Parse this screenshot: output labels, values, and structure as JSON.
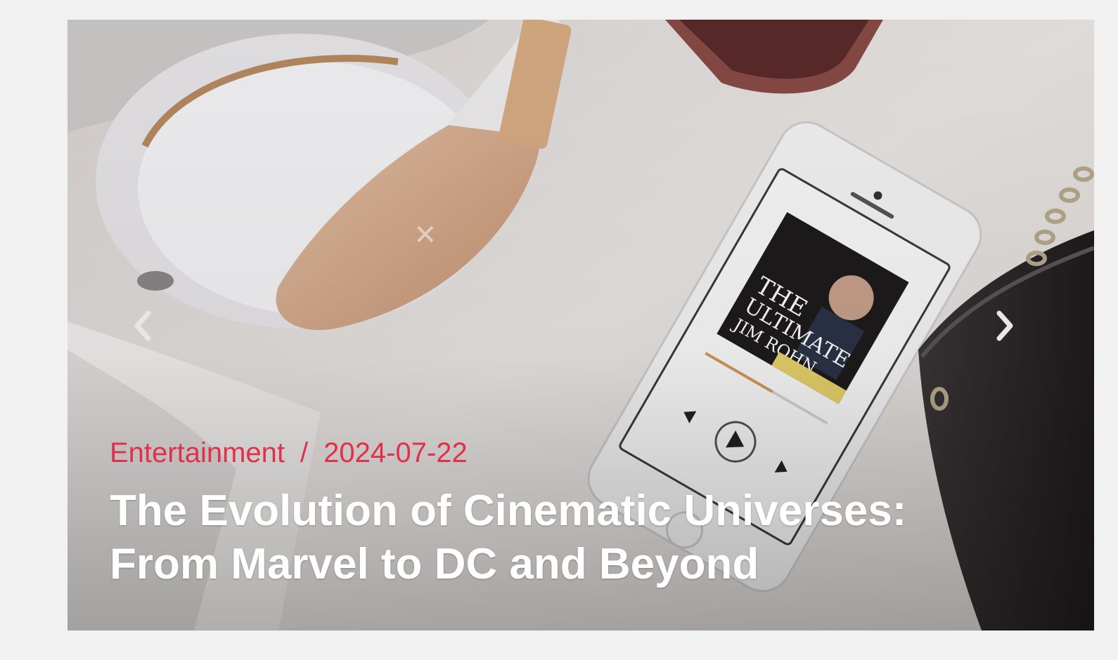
{
  "slide": {
    "category": "Entertainment",
    "separator": "/",
    "date": "2024-07-22",
    "title": "The Evolution of Cinematic Universes: From Marvel to DC and Beyond"
  },
  "icons": {
    "prev": "chevron-left-icon",
    "next": "chevron-right-icon"
  },
  "colors": {
    "accent": "#e0314a",
    "title": "#ffffff",
    "page_background": "#f1f1f1"
  }
}
